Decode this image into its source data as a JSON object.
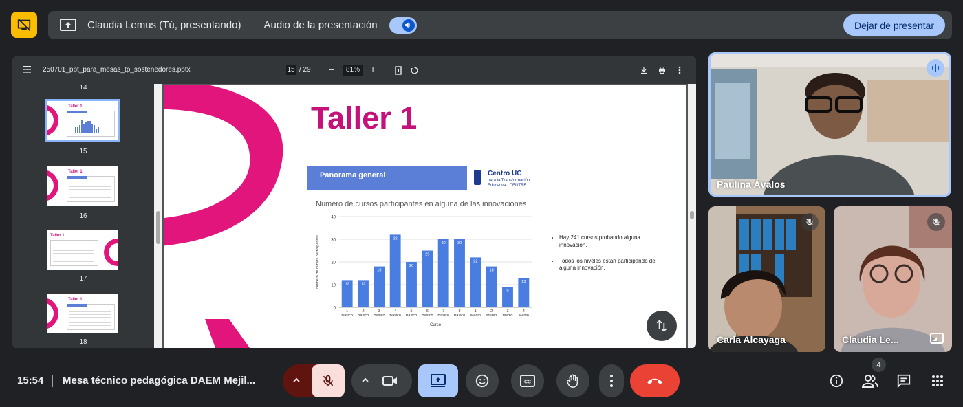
{
  "topbar": {
    "presenter_label": "Claudia Lemus (Tú, presentando)",
    "audio_label": "Audio de la presentación",
    "stop_label": "Dejar de presentar"
  },
  "viewer": {
    "filename": "250701_ppt_para_mesas_tp_sostenedores.pptx",
    "current_page": "15",
    "total_pages": "/ 29",
    "zoom": "81%",
    "thumbnails": [
      {
        "label": "14"
      },
      {
        "label": "15",
        "title": "Taller 1",
        "selected": true
      },
      {
        "label": "16",
        "title": "Taller 1"
      },
      {
        "label": "17",
        "title": "Taller 1"
      },
      {
        "label": "18",
        "title": "Taller 1"
      }
    ]
  },
  "slide": {
    "title": "Taller 1",
    "card_header": "Panorama general",
    "logo": {
      "line1": "Centro UC",
      "line2": "para la Transformación",
      "line3": "Educativa · CENTRE"
    },
    "bullets": [
      "Hay 241 cursos probando alguna innovación.",
      "Todos los niveles están participando de alguna innovación."
    ]
  },
  "chart_data": {
    "type": "bar",
    "title": "Número de cursos participantes en alguna de las innovaciones",
    "xlabel": "Curso",
    "ylabel": "Número de cursos participantes",
    "ylim": [
      0,
      40
    ],
    "yticks": [
      0,
      10,
      20,
      30,
      40
    ],
    "categories": [
      [
        "1",
        "Básico"
      ],
      [
        "2",
        "Básico"
      ],
      [
        "3",
        "Básico"
      ],
      [
        "4",
        "Básico"
      ],
      [
        "5",
        "Básico"
      ],
      [
        "6",
        "Básico"
      ],
      [
        "7",
        "Básico"
      ],
      [
        "8",
        "Básico"
      ],
      [
        "1",
        "Medio"
      ],
      [
        "2",
        "Medio"
      ],
      [
        "3",
        "Medio"
      ],
      [
        "4",
        "Medio"
      ]
    ],
    "values": [
      12,
      12,
      18,
      32,
      20,
      25,
      30,
      30,
      22,
      18,
      9,
      13
    ],
    "color": "#4a7de0",
    "grid": true
  },
  "participants": [
    {
      "name": "Paulina Ávalos",
      "speaking": true
    },
    {
      "name": "Carla Alcayaga",
      "muted": true
    },
    {
      "name": "Claudia Le...",
      "muted": true
    }
  ],
  "bottombar": {
    "time": "15:54",
    "meeting_title": "Mesa técnico pedagógica DAEM Mejil...",
    "participant_count": "4"
  },
  "colors": {
    "accent_yellow": "#fbbc04",
    "accent_blue": "#a8c7fa",
    "end_call_red": "#ea4335",
    "slide_pink": "#c5117a"
  }
}
